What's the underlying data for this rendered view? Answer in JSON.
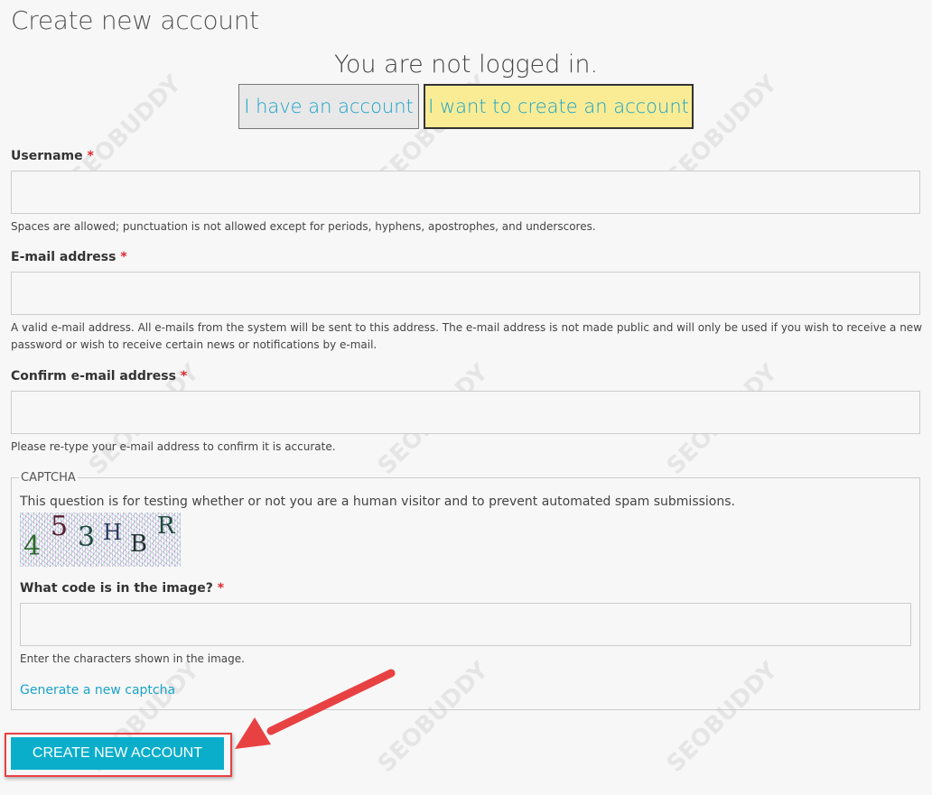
{
  "page_title": "Create new account",
  "status": "You are not logged in.",
  "tabs": {
    "have_account": "I have an account",
    "create_account": "I want to create an account"
  },
  "form": {
    "username": {
      "label": "Username",
      "required": "*",
      "help": "Spaces are allowed; punctuation is not allowed except for periods, hyphens, apostrophes, and underscores.",
      "value": ""
    },
    "email": {
      "label": "E-mail address",
      "required": "*",
      "help": "A valid e-mail address. All e-mails from the system will be sent to this address. The e-mail address is not made public and will only be used if you wish to receive a new password or wish to receive certain news or notifications by e-mail.",
      "value": ""
    },
    "confirm_email": {
      "label": "Confirm e-mail address",
      "required": "*",
      "help": "Please re-type your e-mail address to confirm it is accurate.",
      "value": ""
    }
  },
  "captcha": {
    "legend": "CAPTCHA",
    "description": "This question is for testing whether or not you are a human visitor and to prevent automated spam submissions.",
    "image_code": [
      "4",
      "5",
      "3",
      "H",
      "B",
      "R"
    ],
    "label": "What code is in the image?",
    "required": "*",
    "help": "Enter the characters shown in the image.",
    "regenerate_link": "Generate a new captcha"
  },
  "submit_label": "CREATE NEW ACCOUNT",
  "watermark": "SEOBUDDY",
  "colors": {
    "accent": "#0aaecb",
    "link": "#1aa3c8",
    "highlight": "#f9ec95",
    "annotation": "#e84142"
  }
}
